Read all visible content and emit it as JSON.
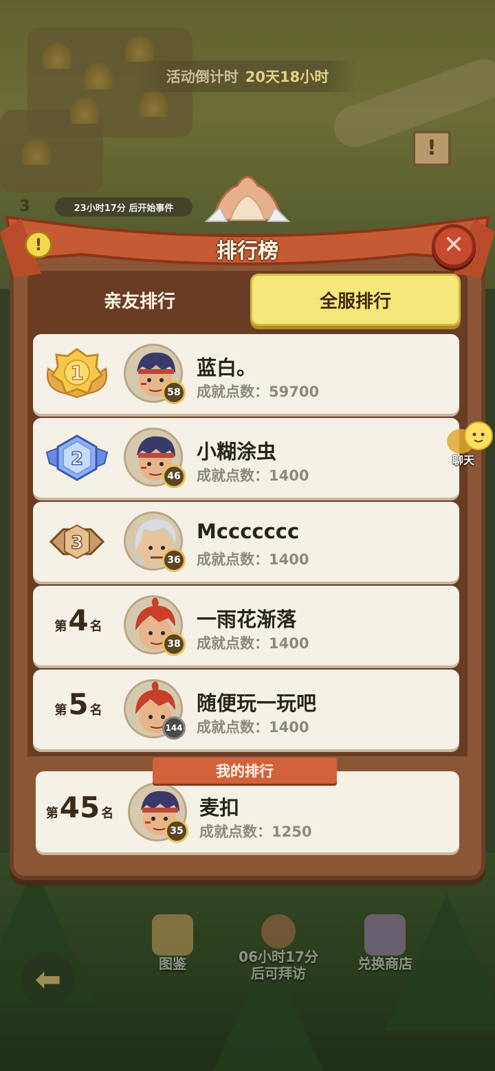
{
  "hud": {
    "timer_label": "活动倒计时",
    "timer_value": "20天18小时",
    "event_countdown": "23小时17分 后开始事件",
    "side_number": "3",
    "notice_icon": "exclamation-board-icon"
  },
  "panel": {
    "title": "排行榜",
    "info_icon": "!",
    "close_icon": "✕"
  },
  "tabs": [
    {
      "label": "亲友排行",
      "active": false
    },
    {
      "label": "全服排行",
      "active": true
    }
  ],
  "rankings": [
    {
      "rank": "1",
      "rank_prefix": "",
      "rank_suffix": "",
      "medal": "gold",
      "name": "蓝白。",
      "score": "成就点数：59700",
      "level": "58",
      "avatar": "headband-boy"
    },
    {
      "rank": "2",
      "rank_prefix": "",
      "rank_suffix": "",
      "medal": "silver",
      "name": "小糊涂虫",
      "score": "成就点数：1400",
      "level": "46",
      "avatar": "headband-boy"
    },
    {
      "rank": "3",
      "rank_prefix": "",
      "rank_suffix": "",
      "medal": "bronze",
      "name": "Mccccccc",
      "score": "成就点数：1400",
      "level": "36",
      "avatar": "white-hair"
    },
    {
      "rank": "4",
      "rank_prefix": "第",
      "rank_suffix": "名",
      "medal": "none",
      "name": "一雨花渐落",
      "score": "成就点数：1400",
      "level": "38",
      "avatar": "red-hair"
    },
    {
      "rank": "5",
      "rank_prefix": "第",
      "rank_suffix": "名",
      "medal": "none",
      "name": "随便玩一玩吧",
      "score": "成就点数：1400",
      "level": "144",
      "avatar": "red-hair"
    }
  ],
  "my_rank": {
    "banner": "我的排行",
    "rank_prefix": "第",
    "rank": "45",
    "rank_suffix": "名",
    "name": "麦扣",
    "score": "成就点数：1250",
    "level": "35",
    "avatar": "headband-boy"
  },
  "chat": {
    "label": "聊天"
  },
  "bottom_nav": [
    {
      "label": "图鉴",
      "icon": "book-icon"
    },
    {
      "label": "06小时17分\n后可拜访",
      "line1": "06小时17分",
      "line2": "后可拜访",
      "icon": "visit-avatar-icon"
    },
    {
      "label": "兑换商店",
      "icon": "shop-icon"
    }
  ],
  "back_icon": "back-arrow-icon",
  "colors": {
    "panel_wood": "#8a5636",
    "row_bg": "#f6f1e6",
    "active_tab": "#f6e77a",
    "close_red": "#c84a2e",
    "banner_red": "#d2623a"
  }
}
